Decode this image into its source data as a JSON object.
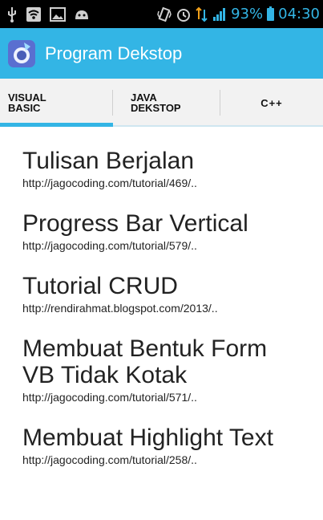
{
  "status_bar": {
    "battery": "93%",
    "time": "04:30",
    "icons": [
      "usb-icon",
      "wifi-icon",
      "image-icon",
      "android-icon",
      "vibrate-icon",
      "alarm-icon",
      "data-transfer-icon",
      "signal-icon",
      "battery-icon"
    ]
  },
  "action_bar": {
    "title": "Program Dekstop",
    "color": "#33b5e5"
  },
  "tabs": [
    {
      "label": "VISUAL\nBASIC",
      "selected": true
    },
    {
      "label": "JAVA\nDEKSTOP",
      "selected": false
    },
    {
      "label": "C++",
      "selected": false
    }
  ],
  "list": [
    {
      "title": "Tulisan Berjalan",
      "url": "http://jagocoding.com/tutorial/469/.."
    },
    {
      "title": "Progress Bar Vertical",
      "url": "http://jagocoding.com/tutorial/579/.."
    },
    {
      "title": "Tutorial CRUD",
      "url": "http://rendirahmat.blogspot.com/2013/.."
    },
    {
      "title": "Membuat Bentuk Form VB Tidak Kotak",
      "url": "http://jagocoding.com/tutorial/571/.."
    },
    {
      "title": "Membuat Highlight Text",
      "url": "http://jagocoding.com/tutorial/258/.."
    }
  ]
}
